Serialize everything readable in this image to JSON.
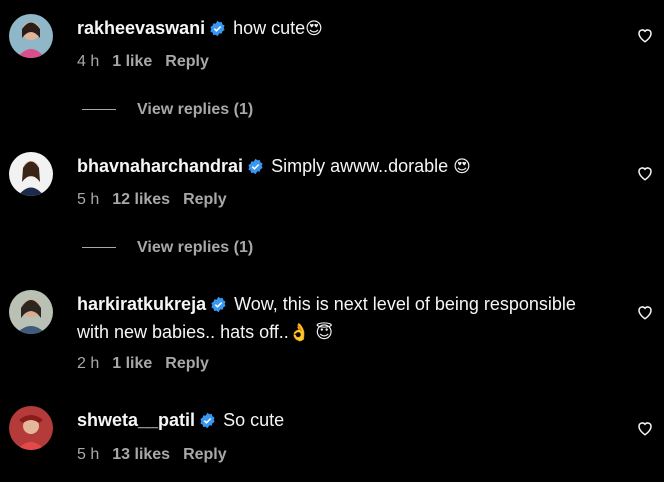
{
  "comments": [
    {
      "username": "rakheevaswani",
      "text": "how cute",
      "emoji": "😍",
      "time": "4 h",
      "likes": "1 like",
      "reply": "Reply",
      "view_replies": "View replies (1)"
    },
    {
      "username": "bhavnaharchandrai",
      "text": "Simply awww..dorable ",
      "emoji": "😍",
      "time": "5 h",
      "likes": "12 likes",
      "reply": "Reply",
      "view_replies": "View replies (1)"
    },
    {
      "username": "harkiratkukreja",
      "text_line1": "Wow, this is next level of being responsible",
      "text_line2": "with new babies.. hats off..",
      "emoji": "👌 😇",
      "time": "2 h",
      "likes": "1 like",
      "reply": "Reply"
    },
    {
      "username": "shweta__patil",
      "text": "So cute",
      "time": "5 h",
      "likes": "13 likes",
      "reply": "Reply"
    }
  ],
  "colors": {
    "background": "#000000",
    "text": "#f5f5f5",
    "muted": "#a8a8a8",
    "verified": "#3897f0"
  },
  "icons": {
    "verified": "verified-badge-icon",
    "like": "heart-outline-icon"
  }
}
